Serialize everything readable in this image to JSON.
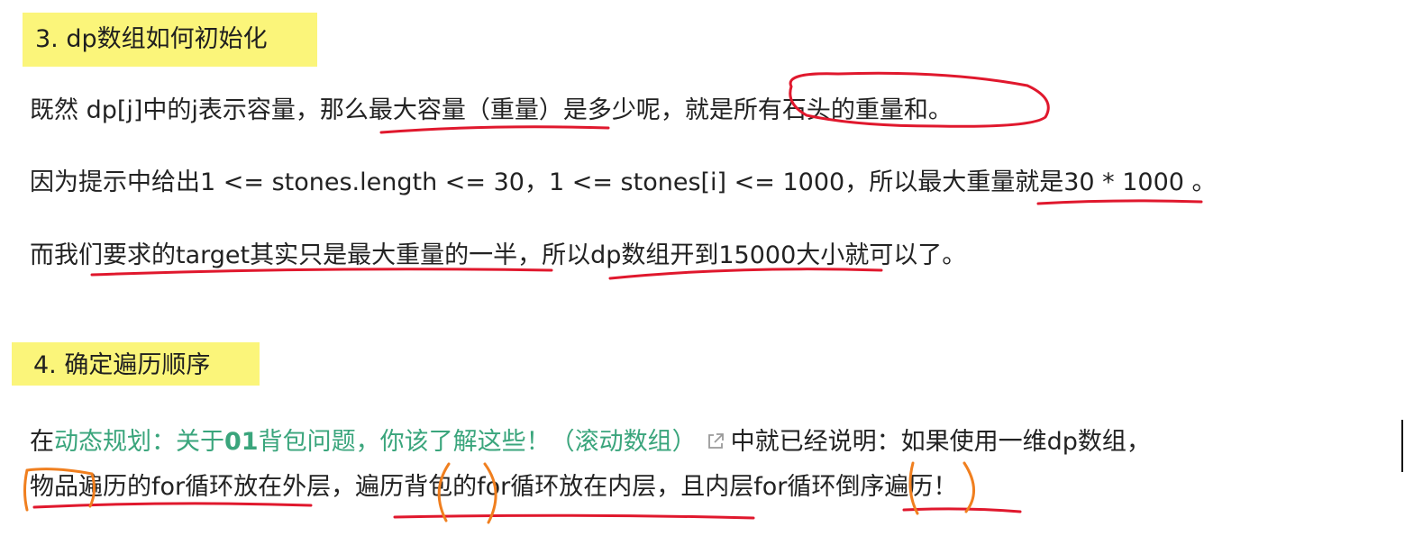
{
  "section3": {
    "heading": "3. dp数组如何初始化",
    "p1": "既然 dp[j]中的j表示容量，那么最大容量（重量）是多少呢，就是所有石头的重量和。",
    "p2": "因为提示中给出1 <= stones.length <= 30，1 <= stones[i] <= 1000，所以最大重量就是30 * 1000 。",
    "p3": "而我们要求的target其实只是最大重量的一半，所以dp数组开到15000大小就可以了。"
  },
  "section4": {
    "heading": "4. 确定遍历顺序",
    "p4_prefix": "在",
    "link_a": "动态规划：关于",
    "link_bold": "01",
    "link_b": "背包问题，你该了解这些！（滚动数组）",
    "p4_suffix": "中就已经说明：如果使用一维dp数组，",
    "p5": "物品遍历的for循环放在外层，遍历背包的for循环放在内层，且内层for循环倒序遍历！"
  },
  "colors": {
    "highlight": "#fbf57a",
    "link": "#3aa57c",
    "red_annotation": "#e0182d",
    "orange_annotation": "#f07f1f"
  },
  "icons": {
    "external_link": "external-link-icon"
  }
}
